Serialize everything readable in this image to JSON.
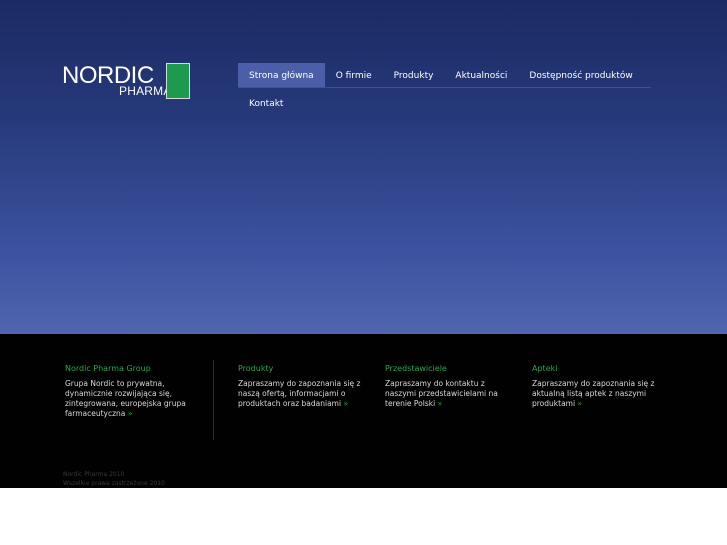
{
  "logo": {
    "word": "NORDIC",
    "sub": "PHARMA",
    "brand_green": "#1e9a4f"
  },
  "nav": {
    "items": [
      {
        "label": "Strona główna",
        "active": true
      },
      {
        "label": "O firmie"
      },
      {
        "label": "Produkty"
      },
      {
        "label": "Aktualności"
      },
      {
        "label": "Dostępność produktów"
      }
    ],
    "second_row": {
      "label": "Kontakt"
    }
  },
  "footer": {
    "columns": [
      {
        "heading": "Nordic Pharma Group",
        "text": "Grupa Nordic to prywatna, dynamicznie rozwijająca się, zintegrowana, europejska grupa farmaceutyczna",
        "more": "»"
      },
      {
        "heading": "Produkty",
        "text": "Zapraszamy do zapoznania się z naszą ofertą, informacjami o produktach oraz badaniami",
        "more": "»"
      },
      {
        "heading": "Przedstawiciele",
        "text": "Zapraszamy do kontaktu z naszymi przedstawicielami na terenie Polski",
        "more": "»"
      },
      {
        "heading": "Apteki",
        "text": "Zapraszamy do zapoznania się z aktualną listą aptek z naszymi produktami",
        "more": "»"
      }
    ],
    "copyright_line1": "Nordic Pharma 2010",
    "copyright_line2": "Wszelkie prawa zastrzeżone 2010"
  },
  "colors": {
    "hero_top": "#1b2a63",
    "hero_bottom": "#5065ad",
    "footer_bg": "#010101",
    "accent_green": "#2aa551"
  }
}
